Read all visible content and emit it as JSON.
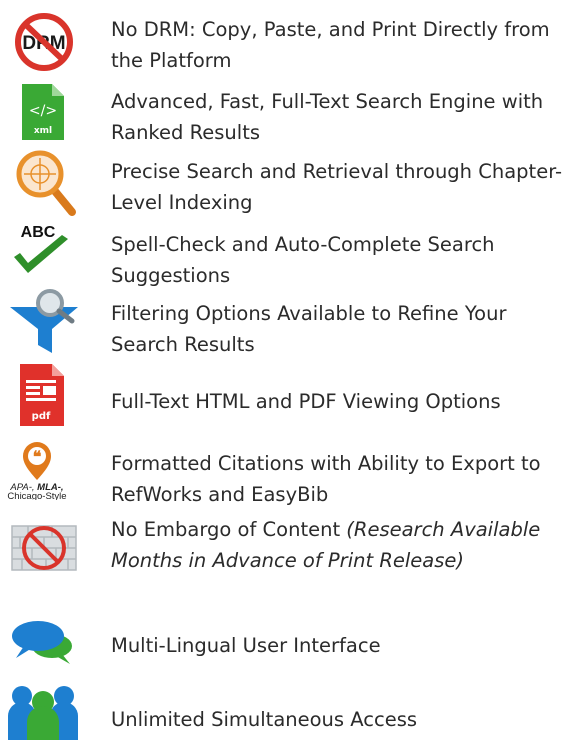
{
  "features": [
    {
      "icon": "no-drm-icon",
      "text": "No DRM: Copy, Paste, and Print Directly from the Platform",
      "icon_label": "DRM"
    },
    {
      "icon": "xml-file-icon",
      "text": "Advanced, Fast, Full-Text Search Engine with Ranked Results",
      "icon_label": "xml"
    },
    {
      "icon": "magnifier-crosshair-icon",
      "text": "Precise Search and Retrieval through Chapter-Level Indexing"
    },
    {
      "icon": "spellcheck-icon",
      "text": "Spell-Check and Auto-Complete Search Suggestions",
      "icon_label": "ABC"
    },
    {
      "icon": "filter-funnel-icon",
      "text": "Filtering Options Available to Refine Your Search Results"
    },
    {
      "icon": "pdf-file-icon",
      "text": "Full-Text HTML and PDF Viewing Options",
      "icon_label": "pdf"
    },
    {
      "icon": "citation-pin-icon",
      "text": "Formatted Citations with Ability to Export to RefWorks and EasyBib",
      "icon_label_a": "APA-,",
      "icon_label_b": "MLA-,",
      "icon_label_c": "Chicago-Style"
    },
    {
      "icon": "no-embargo-wall-icon",
      "text": "No Embargo of Content ",
      "text_em": "(Research Available Months in Advance of Print Release)"
    },
    {
      "icon": "speech-bubbles-icon",
      "text": "Multi-Lingual User Interface"
    },
    {
      "icon": "users-group-icon",
      "text": "Unlimited Simultaneous Access"
    }
  ],
  "colors": {
    "text": "#2b2b2b",
    "red": "#d9342b",
    "green": "#3aa935",
    "orange": "#e8912c",
    "blue": "#1e7fd0"
  }
}
